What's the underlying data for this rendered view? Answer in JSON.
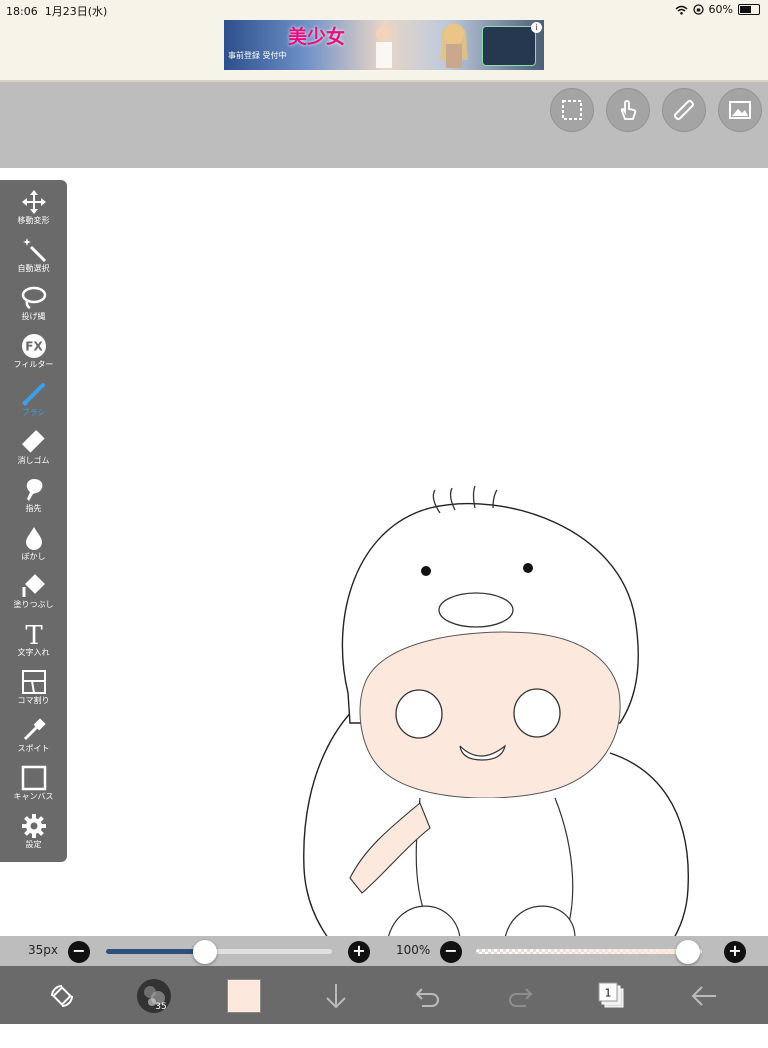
{
  "status_bar": {
    "time": "18:06",
    "date": "1月23日(水)",
    "battery": "60%",
    "battery_level": 0.6
  },
  "ad": {
    "title": "美少女",
    "subtitle": "事前登録 受付中",
    "info": "i"
  },
  "top_toolbar": {
    "buttons": [
      {
        "name": "selection-icon"
      },
      {
        "name": "touch-gesture-icon"
      },
      {
        "name": "ruler-icon"
      },
      {
        "name": "image-icon"
      }
    ]
  },
  "side_toolbar": {
    "tools": [
      {
        "label": "移動変形",
        "icon": "move-icon",
        "active": false
      },
      {
        "label": "自動選択",
        "icon": "magic-wand-icon",
        "active": false
      },
      {
        "label": "投げ縄",
        "icon": "lasso-icon",
        "active": false
      },
      {
        "label": "フィルター",
        "icon": "fx-icon",
        "active": false
      },
      {
        "label": "ブラシ",
        "icon": "brush-icon",
        "active": true
      },
      {
        "label": "消しゴム",
        "icon": "eraser-icon",
        "active": false
      },
      {
        "label": "指先",
        "icon": "smudge-icon",
        "active": false
      },
      {
        "label": "ぼかし",
        "icon": "blur-icon",
        "active": false
      },
      {
        "label": "塗りつぶし",
        "icon": "fill-bucket-icon",
        "active": false
      },
      {
        "label": "文字入れ",
        "icon": "text-icon",
        "active": false
      },
      {
        "label": "コマ割り",
        "icon": "frame-divider-icon",
        "active": false
      },
      {
        "label": "スポイト",
        "icon": "eyedropper-icon",
        "active": false
      },
      {
        "label": "キャンバス",
        "icon": "canvas-icon",
        "active": false
      },
      {
        "label": "設定",
        "icon": "gear-icon",
        "active": false
      }
    ]
  },
  "slider_bar": {
    "size_label": "35px",
    "size_fraction": 0.44,
    "opacity_label": "100%",
    "opacity_fraction": 1.0,
    "minus": "−",
    "plus": "+"
  },
  "bottom_bar": {
    "brush_size_badge": "35",
    "current_color": "#fde8de",
    "layer_count": "1",
    "icons": [
      "rotate-canvas-icon",
      "brush-preview-icon",
      "color-swatch-icon",
      "download-icon",
      "undo-icon",
      "redo-icon",
      "layers-icon",
      "back-icon"
    ]
  },
  "colors": {
    "toolbar_gray": "#bdbdbd",
    "panel_dark": "#6a6a6a",
    "active_blue": "#3aa0e8",
    "skin": "#fde8de"
  }
}
